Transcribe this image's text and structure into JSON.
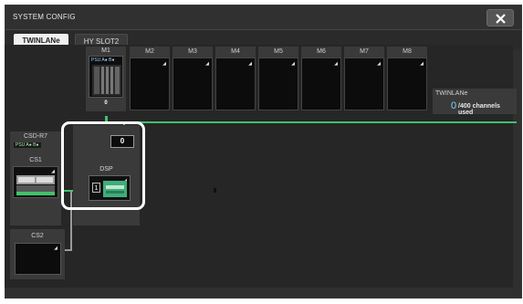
{
  "window": {
    "title": "SYSTEM CONFIG"
  },
  "tabs": [
    {
      "label": "TWINLANe"
    },
    {
      "label": "HY SLOT2"
    }
  ],
  "slots": [
    {
      "label": "M1",
      "psu": "PSU A● B●",
      "count": "0"
    },
    {
      "label": "M2"
    },
    {
      "label": "M3"
    },
    {
      "label": "M4"
    },
    {
      "label": "M5"
    },
    {
      "label": "M6"
    },
    {
      "label": "M7"
    },
    {
      "label": "M8"
    }
  ],
  "twinlane": {
    "name": "TWINLANe",
    "used": "0",
    "total": "/400 channels used"
  },
  "csd": {
    "label": "CSD-R7",
    "psu": "PSU A● B●",
    "cs1": "CS1"
  },
  "dsp": {
    "label": "DSP",
    "count": "0",
    "num": "1"
  },
  "cs2": {
    "label": "CS2"
  },
  "colors": {
    "accent": "#3fc26a",
    "info": "#7fd0ff",
    "highlight": "#ffffff"
  }
}
